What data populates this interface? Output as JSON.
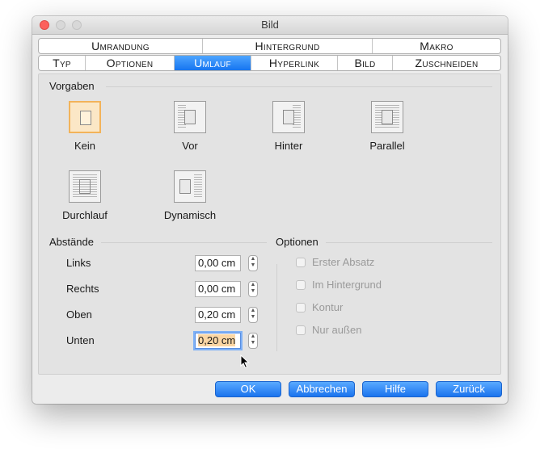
{
  "window": {
    "title": "Bild"
  },
  "tabs": {
    "row1": [
      "Umrandung",
      "Hintergrund",
      "Makro"
    ],
    "row2": [
      "Typ",
      "Optionen",
      "Umlauf",
      "Hyperlink",
      "Bild",
      "Zuschneiden"
    ],
    "active": "Umlauf"
  },
  "defaults": {
    "label": "Vorgaben",
    "items": [
      {
        "label": "Kein",
        "icon": "wrap-none-icon",
        "selected": true
      },
      {
        "label": "Vor",
        "icon": "wrap-before-icon",
        "selected": false
      },
      {
        "label": "Hinter",
        "icon": "wrap-after-icon",
        "selected": false
      },
      {
        "label": "Parallel",
        "icon": "wrap-parallel-icon",
        "selected": false
      },
      {
        "label": "Durchlauf",
        "icon": "wrap-through-icon",
        "selected": false
      },
      {
        "label": "Dynamisch",
        "icon": "wrap-optimal-icon",
        "selected": false
      }
    ]
  },
  "spacing": {
    "label": "Abstände",
    "rows": [
      {
        "label": "Links",
        "value": "0,00 cm"
      },
      {
        "label": "Rechts",
        "value": "0,00 cm"
      },
      {
        "label": "Oben",
        "value": "0,20 cm"
      },
      {
        "label": "Unten",
        "value": "0,20 cm"
      }
    ]
  },
  "options": {
    "label": "Optionen",
    "items": [
      {
        "label": "Erster Absatz",
        "checked": false,
        "enabled": false
      },
      {
        "label": "Im Hintergrund",
        "checked": false,
        "enabled": false
      },
      {
        "label": "Kontur",
        "checked": false,
        "enabled": false
      },
      {
        "label": "Nur außen",
        "checked": false,
        "enabled": false
      }
    ]
  },
  "buttons": {
    "ok": "OK",
    "cancel": "Abbrechen",
    "help": "Hilfe",
    "back": "Zurück"
  },
  "colors": {
    "accent": "#1a73ee",
    "selection": "#f2b35a"
  }
}
